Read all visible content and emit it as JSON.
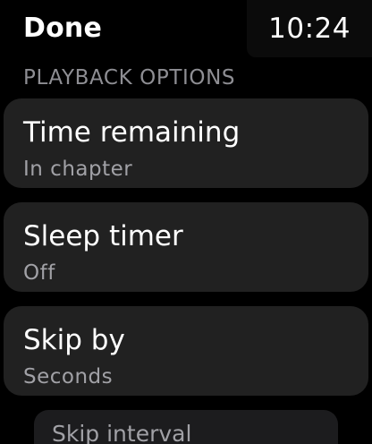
{
  "header": {
    "done_label": "Done",
    "time": "10:24"
  },
  "section": {
    "title": "PLAYBACK OPTIONS"
  },
  "options": [
    {
      "title": "Time remaining",
      "value": "In chapter"
    },
    {
      "title": "Sleep timer",
      "value": "Off"
    },
    {
      "title": "Skip by",
      "value": "Seconds"
    }
  ],
  "sub_option": {
    "label": "Skip interval"
  },
  "colors": {
    "background": "#000000",
    "cell_background": "#212121",
    "secondary_text": "#a1a1a6",
    "section_header_text": "#8e8e93"
  }
}
